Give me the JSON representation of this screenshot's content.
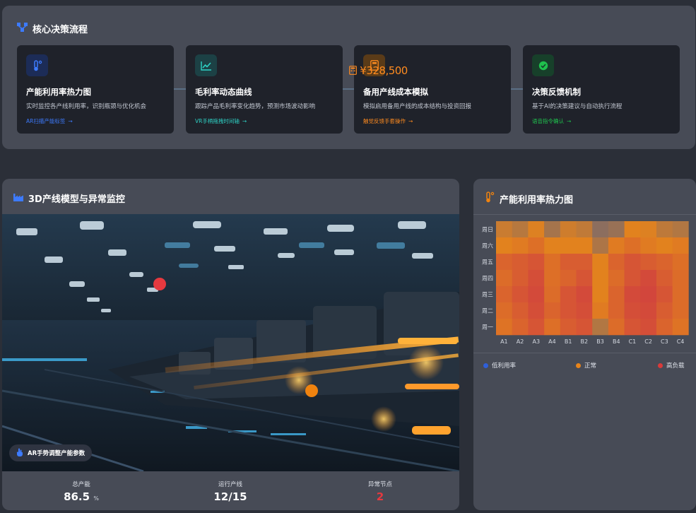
{
  "flow": {
    "title": "核心决策流程",
    "floating_amount": "¥328,500",
    "cards": [
      {
        "title": "产能利用率热力图",
        "desc": "实时监控各产线利用率，识别瓶颈与优化机会",
        "link": "AR扫描产能标签",
        "link_color": "#3d7bff",
        "icon": "thermometer-icon"
      },
      {
        "title": "毛利率动态曲线",
        "desc": "跟踪产品毛利率变化趋势，预测市场波动影响",
        "link": "VR手柄拖拽时间轴",
        "link_color": "#2ed3c6",
        "icon": "line-chart-icon"
      },
      {
        "title": "备用产线成本模拟",
        "desc": "模拟启用备用产线的成本结构与投资回报",
        "link": "触觉反馈手套操作",
        "link_color": "#ff8b1f",
        "icon": "calculator-icon"
      },
      {
        "title": "决策反馈机制",
        "desc": "基于AI的决策建议与自动执行流程",
        "link": "语音指令确认",
        "link_color": "#1fc24d",
        "icon": "check-circle-icon"
      }
    ]
  },
  "model": {
    "title": "3D产线模型与异常监控",
    "ar_button": "AR手势调整产能参数",
    "stats": [
      {
        "label": "总产能",
        "value": "86.5",
        "unit": "%"
      },
      {
        "label": "运行产线",
        "value": "12/15",
        "unit": ""
      },
      {
        "label": "异常节点",
        "value": "2",
        "unit": ""
      }
    ],
    "alert_color": "#e6393f",
    "warn_color": "#f0830f"
  },
  "heatmap": {
    "title": "产能利用率热力图",
    "rows": [
      "周日",
      "周六",
      "周五",
      "周四",
      "周三",
      "周二",
      "周一"
    ],
    "cols": [
      "A1",
      "A2",
      "A3",
      "A4",
      "B1",
      "B2",
      "B3",
      "B4",
      "C1",
      "C2",
      "C3",
      "C4"
    ],
    "values": [
      [
        0.7,
        0.62,
        0.78,
        0.55,
        0.72,
        0.66,
        0.45,
        0.5,
        0.8,
        0.78,
        0.65,
        0.6
      ],
      [
        0.8,
        0.82,
        0.85,
        0.8,
        0.8,
        0.8,
        0.58,
        0.82,
        0.85,
        0.82,
        0.8,
        0.82
      ],
      [
        0.88,
        0.9,
        0.92,
        0.85,
        0.9,
        0.9,
        0.8,
        0.88,
        0.92,
        0.9,
        0.88,
        0.85
      ],
      [
        0.86,
        0.9,
        0.94,
        0.85,
        0.88,
        0.92,
        0.8,
        0.86,
        0.92,
        0.95,
        0.9,
        0.86
      ],
      [
        0.88,
        0.92,
        0.95,
        0.86,
        0.92,
        0.95,
        0.8,
        0.88,
        0.95,
        0.96,
        0.92,
        0.86
      ],
      [
        0.86,
        0.9,
        0.94,
        0.88,
        0.92,
        0.94,
        0.82,
        0.88,
        0.94,
        0.95,
        0.9,
        0.86
      ],
      [
        0.84,
        0.88,
        0.92,
        0.85,
        0.9,
        0.92,
        0.6,
        0.86,
        0.92,
        0.94,
        0.88,
        0.84
      ]
    ],
    "legend": [
      {
        "label": "低利用率",
        "color": "#2f5fd9"
      },
      {
        "label": "正常",
        "color": "#e8841a"
      },
      {
        "label": "高负载",
        "color": "#d93a3a"
      }
    ]
  }
}
